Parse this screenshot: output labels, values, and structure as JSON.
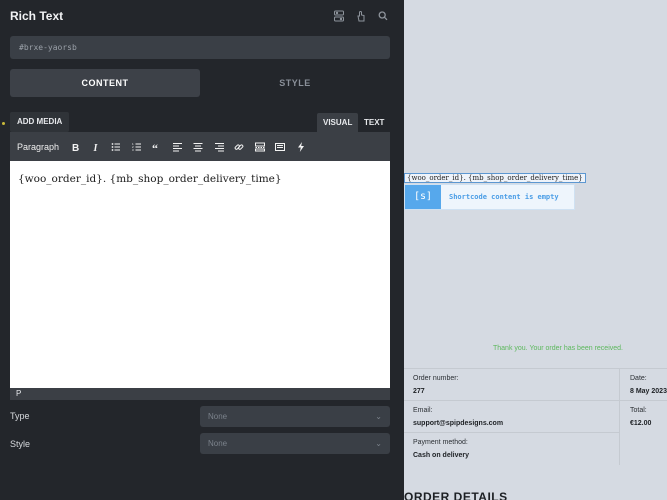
{
  "panel": {
    "title": "Rich Text",
    "header_icons": [
      "toggle-icon",
      "hand-pointer-icon",
      "search-icon"
    ],
    "element_id": "#brxe-yaorsb",
    "tabs": [
      {
        "label": "CONTENT",
        "active": true
      },
      {
        "label": "STYLE",
        "active": false
      }
    ],
    "editor": {
      "add_media_label": "ADD MEDIA",
      "modes": [
        {
          "label": "VISUAL",
          "active": true
        },
        {
          "label": "TEXT",
          "active": false
        }
      ],
      "format_select": "Paragraph",
      "toolbar_icons": [
        "bold-icon",
        "italic-icon",
        "bullet-list-icon",
        "numbered-list-icon",
        "blockquote-icon",
        "align-left-icon",
        "align-center-icon",
        "align-right-icon",
        "link-icon",
        "read-more-icon",
        "toolbar-toggle-icon",
        "dynamic-data-icon"
      ],
      "content": "{woo_order_id}. {mb_shop_order_delivery_time}",
      "status_path": "P"
    },
    "controls": [
      {
        "label": "Type",
        "value": "None"
      },
      {
        "label": "Style",
        "value": "None"
      }
    ]
  },
  "preview": {
    "shortcode_raw": "{woo_order_id}. {mb_shop_order_delivery_time}",
    "shortcode_icon": "[s]",
    "shortcode_message": "Shortcode content is empty",
    "thank_you": "Thank you. Your order has been received.",
    "order_overview": [
      {
        "label": "Order number:",
        "value": "277"
      },
      {
        "label": "Date:",
        "value": "8 May 2023"
      },
      {
        "label": "Email:",
        "value": "support@spipdesigns.com"
      },
      {
        "label": "Total:",
        "value": "€12.00"
      },
      {
        "label": "Payment method:",
        "value": "Cash on delivery"
      }
    ],
    "order_details_heading": "ORDER DETAILS"
  },
  "colors": {
    "panel_bg": "#23262b",
    "canvas_bg": "#d5dae2",
    "shortcode_accent": "#56a8ec",
    "success_text": "#5cb85c"
  }
}
